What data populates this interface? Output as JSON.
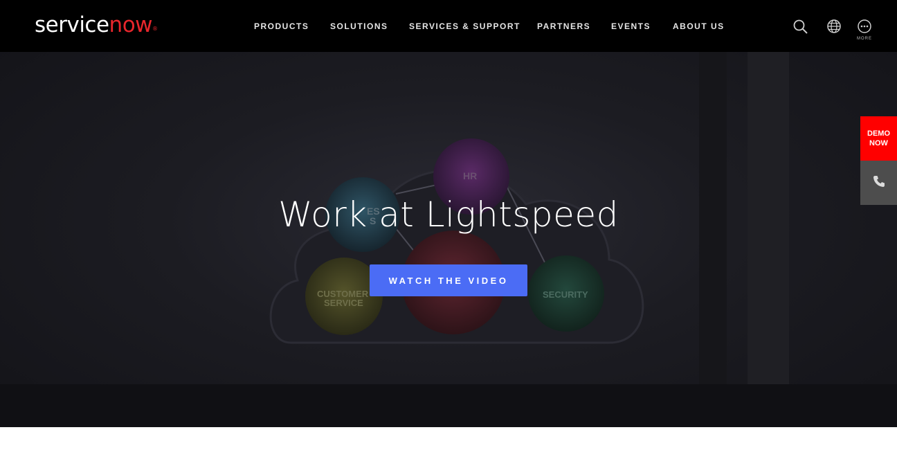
{
  "header": {
    "logo_white": "service",
    "logo_red": "now",
    "nav": [
      "PRODUCTS",
      "SOLUTIONS",
      "SERVICES & SUPPORT",
      "PARTNERS",
      "EVENTS",
      "ABOUT US"
    ],
    "more_label": "MORE",
    "icons": [
      "search-icon",
      "globe-icon",
      "more-icon"
    ]
  },
  "hero": {
    "title": "Work at Lightspeed",
    "cta_label": "WATCH THE VIDEO",
    "bubbles": {
      "hr": "HR",
      "security": "SECURITY",
      "customer_service_1": "CUSTOMER",
      "customer_service_2": "SERVICE",
      "partial_1": "ES",
      "partial_2": "S"
    }
  },
  "side": {
    "demo_line1": "DEMO",
    "demo_line2": "NOW",
    "phone_icon": "phone-icon"
  },
  "colors": {
    "brand_red": "#e8262c",
    "cta_blue": "#4b6cf5",
    "demo_red": "#ff0000"
  }
}
